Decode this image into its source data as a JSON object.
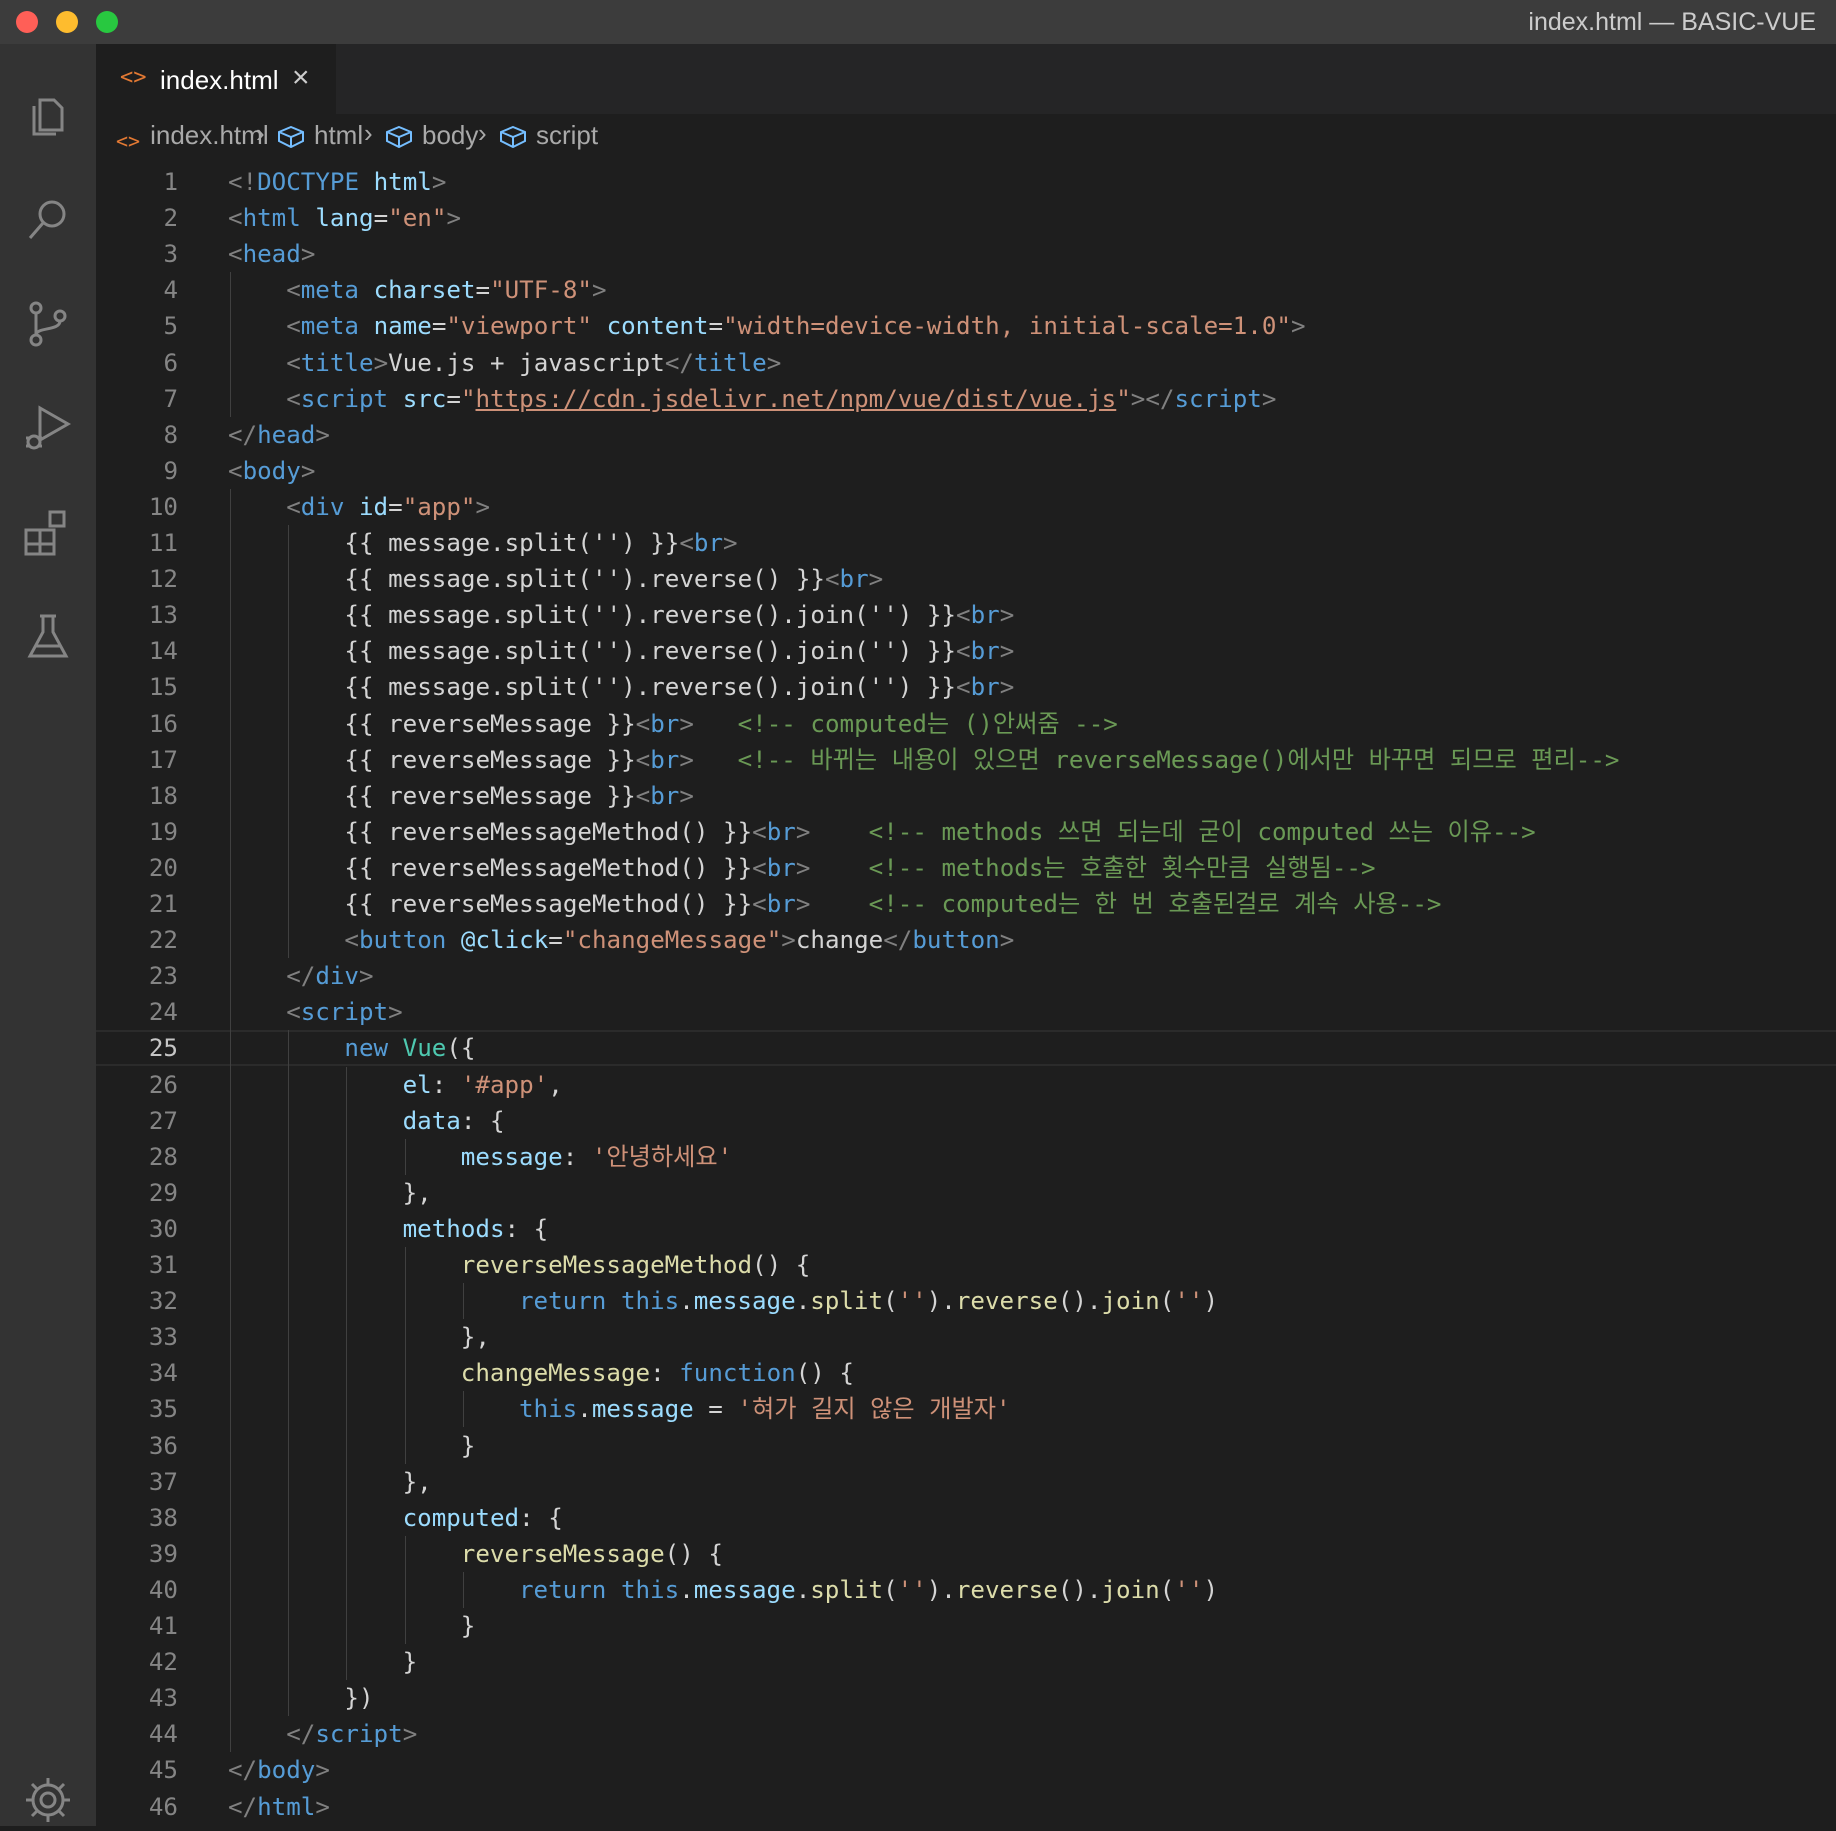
{
  "window": {
    "title": "index.html — BASIC-VUE"
  },
  "activity_bar": {
    "items": [
      {
        "name": "explorer-icon"
      },
      {
        "name": "search-icon"
      },
      {
        "name": "source-control-icon"
      },
      {
        "name": "run-debug-icon"
      },
      {
        "name": "extensions-icon"
      },
      {
        "name": "testing-icon"
      },
      {
        "name": "settings-gear-icon"
      }
    ]
  },
  "tab": {
    "label": "index.html",
    "close": "×"
  },
  "breadcrumb": {
    "items": [
      "index.html",
      "html",
      "body",
      "script"
    ]
  },
  "editor": {
    "current_line": 25,
    "lines": [
      {
        "n": "1",
        "indent": 0,
        "tokens": [
          [
            "p",
            "<!"
          ],
          [
            "tag",
            "DOCTYPE"
          ],
          [
            "txt",
            " "
          ],
          [
            "attr",
            "html"
          ],
          [
            "p",
            ">"
          ]
        ]
      },
      {
        "n": "2",
        "indent": 0,
        "tokens": [
          [
            "p",
            "<"
          ],
          [
            "tag",
            "html"
          ],
          [
            "txt",
            " "
          ],
          [
            "attr",
            "lang"
          ],
          [
            "txt",
            "="
          ],
          [
            "str",
            "\"en\""
          ],
          [
            "p",
            ">"
          ]
        ]
      },
      {
        "n": "3",
        "indent": 0,
        "tokens": [
          [
            "p",
            "<"
          ],
          [
            "tag",
            "head"
          ],
          [
            "p",
            ">"
          ]
        ]
      },
      {
        "n": "4",
        "indent": 1,
        "tokens": [
          [
            "p",
            "<"
          ],
          [
            "tag",
            "meta"
          ],
          [
            "txt",
            " "
          ],
          [
            "attr",
            "charset"
          ],
          [
            "txt",
            "="
          ],
          [
            "str",
            "\"UTF-8\""
          ],
          [
            "p",
            ">"
          ]
        ]
      },
      {
        "n": "5",
        "indent": 1,
        "tokens": [
          [
            "p",
            "<"
          ],
          [
            "tag",
            "meta"
          ],
          [
            "txt",
            " "
          ],
          [
            "attr",
            "name"
          ],
          [
            "txt",
            "="
          ],
          [
            "str",
            "\"viewport\""
          ],
          [
            "txt",
            " "
          ],
          [
            "attr",
            "content"
          ],
          [
            "txt",
            "="
          ],
          [
            "str",
            "\"width=device-width, initial-scale=1.0\""
          ],
          [
            "p",
            ">"
          ]
        ]
      },
      {
        "n": "6",
        "indent": 1,
        "tokens": [
          [
            "p",
            "<"
          ],
          [
            "tag",
            "title"
          ],
          [
            "p",
            ">"
          ],
          [
            "txt",
            "Vue.js + javascript"
          ],
          [
            "p",
            "</"
          ],
          [
            "tag",
            "title"
          ],
          [
            "p",
            ">"
          ]
        ]
      },
      {
        "n": "7",
        "indent": 1,
        "tokens": [
          [
            "p",
            "<"
          ],
          [
            "tag",
            "script"
          ],
          [
            "txt",
            " "
          ],
          [
            "attr",
            "src"
          ],
          [
            "txt",
            "="
          ],
          [
            "str",
            "\""
          ],
          [
            "link",
            "https://cdn.jsdelivr.net/npm/vue/dist/vue.js"
          ],
          [
            "str",
            "\""
          ],
          [
            "p",
            "></"
          ],
          [
            "tag",
            "script"
          ],
          [
            "p",
            ">"
          ]
        ]
      },
      {
        "n": "8",
        "indent": 0,
        "tokens": [
          [
            "p",
            "</"
          ],
          [
            "tag",
            "head"
          ],
          [
            "p",
            ">"
          ]
        ]
      },
      {
        "n": "9",
        "indent": 0,
        "tokens": [
          [
            "p",
            "<"
          ],
          [
            "tag",
            "body"
          ],
          [
            "p",
            ">"
          ]
        ]
      },
      {
        "n": "10",
        "indent": 1,
        "tokens": [
          [
            "p",
            "<"
          ],
          [
            "tag",
            "div"
          ],
          [
            "txt",
            " "
          ],
          [
            "attr",
            "id"
          ],
          [
            "txt",
            "="
          ],
          [
            "str",
            "\"app\""
          ],
          [
            "p",
            ">"
          ]
        ]
      },
      {
        "n": "11",
        "indent": 2,
        "tokens": [
          [
            "txt",
            "{{ message.split('') }}"
          ],
          [
            "p",
            "<"
          ],
          [
            "tag",
            "br"
          ],
          [
            "p",
            ">"
          ]
        ]
      },
      {
        "n": "12",
        "indent": 2,
        "tokens": [
          [
            "txt",
            "{{ message.split('').reverse() }}"
          ],
          [
            "p",
            "<"
          ],
          [
            "tag",
            "br"
          ],
          [
            "p",
            ">"
          ]
        ]
      },
      {
        "n": "13",
        "indent": 2,
        "tokens": [
          [
            "txt",
            "{{ message.split('').reverse().join('') }}"
          ],
          [
            "p",
            "<"
          ],
          [
            "tag",
            "br"
          ],
          [
            "p",
            ">"
          ]
        ]
      },
      {
        "n": "14",
        "indent": 2,
        "tokens": [
          [
            "txt",
            "{{ message.split('').reverse().join('') }}"
          ],
          [
            "p",
            "<"
          ],
          [
            "tag",
            "br"
          ],
          [
            "p",
            ">"
          ]
        ]
      },
      {
        "n": "15",
        "indent": 2,
        "tokens": [
          [
            "txt",
            "{{ message.split('').reverse().join('') }}"
          ],
          [
            "p",
            "<"
          ],
          [
            "tag",
            "br"
          ],
          [
            "p",
            ">"
          ]
        ]
      },
      {
        "n": "16",
        "indent": 2,
        "tokens": [
          [
            "txt",
            "{{ reverseMessage }}"
          ],
          [
            "p",
            "<"
          ],
          [
            "tag",
            "br"
          ],
          [
            "p",
            ">"
          ],
          [
            "txt",
            "   "
          ],
          [
            "cmt",
            "<!-- computed는 ()안써줌 -->"
          ]
        ]
      },
      {
        "n": "17",
        "indent": 2,
        "tokens": [
          [
            "txt",
            "{{ reverseMessage }}"
          ],
          [
            "p",
            "<"
          ],
          [
            "tag",
            "br"
          ],
          [
            "p",
            ">"
          ],
          [
            "txt",
            "   "
          ],
          [
            "cmt",
            "<!-- 바뀌는 내용이 있으면 reverseMessage()에서만 바꾸면 되므로 편리-->"
          ]
        ]
      },
      {
        "n": "18",
        "indent": 2,
        "tokens": [
          [
            "txt",
            "{{ reverseMessage }}"
          ],
          [
            "p",
            "<"
          ],
          [
            "tag",
            "br"
          ],
          [
            "p",
            ">"
          ]
        ]
      },
      {
        "n": "19",
        "indent": 2,
        "tokens": [
          [
            "txt",
            "{{ reverseMessageMethod() }}"
          ],
          [
            "p",
            "<"
          ],
          [
            "tag",
            "br"
          ],
          [
            "p",
            ">"
          ],
          [
            "txt",
            "    "
          ],
          [
            "cmt",
            "<!-- methods 쓰면 되는데 굳이 computed 쓰는 이유-->"
          ]
        ]
      },
      {
        "n": "20",
        "indent": 2,
        "tokens": [
          [
            "txt",
            "{{ reverseMessageMethod() }}"
          ],
          [
            "p",
            "<"
          ],
          [
            "tag",
            "br"
          ],
          [
            "p",
            ">"
          ],
          [
            "txt",
            "    "
          ],
          [
            "cmt",
            "<!-- methods는 호출한 횟수만큼 실행됨-->"
          ]
        ]
      },
      {
        "n": "21",
        "indent": 2,
        "tokens": [
          [
            "txt",
            "{{ reverseMessageMethod() }}"
          ],
          [
            "p",
            "<"
          ],
          [
            "tag",
            "br"
          ],
          [
            "p",
            ">"
          ],
          [
            "txt",
            "    "
          ],
          [
            "cmt",
            "<!-- computed는 한 번 호출된걸로 계속 사용-->"
          ]
        ]
      },
      {
        "n": "22",
        "indent": 2,
        "tokens": [
          [
            "p",
            "<"
          ],
          [
            "tag",
            "button"
          ],
          [
            "txt",
            " "
          ],
          [
            "attr",
            "@click"
          ],
          [
            "txt",
            "="
          ],
          [
            "str",
            "\"changeMessage\""
          ],
          [
            "p",
            ">"
          ],
          [
            "txt",
            "change"
          ],
          [
            "p",
            "</"
          ],
          [
            "tag",
            "button"
          ],
          [
            "p",
            ">"
          ]
        ]
      },
      {
        "n": "23",
        "indent": 1,
        "tokens": [
          [
            "p",
            "</"
          ],
          [
            "tag",
            "div"
          ],
          [
            "p",
            ">"
          ]
        ]
      },
      {
        "n": "24",
        "indent": 1,
        "tokens": [
          [
            "p",
            "<"
          ],
          [
            "tag",
            "script"
          ],
          [
            "p",
            ">"
          ]
        ]
      },
      {
        "n": "25",
        "indent": 2,
        "tokens": [
          [
            "kw",
            "new"
          ],
          [
            "txt",
            " "
          ],
          [
            "cls",
            "Vue"
          ],
          [
            "txt",
            "({"
          ]
        ]
      },
      {
        "n": "26",
        "indent": 3,
        "tokens": [
          [
            "prop",
            "el"
          ],
          [
            "txt",
            ": "
          ],
          [
            "str",
            "'#app'"
          ],
          [
            "txt",
            ","
          ]
        ]
      },
      {
        "n": "27",
        "indent": 3,
        "tokens": [
          [
            "prop",
            "data"
          ],
          [
            "txt",
            ": {"
          ]
        ]
      },
      {
        "n": "28",
        "indent": 4,
        "tokens": [
          [
            "prop",
            "message"
          ],
          [
            "txt",
            ": "
          ],
          [
            "str",
            "'안녕하세요'"
          ]
        ]
      },
      {
        "n": "29",
        "indent": 3,
        "tokens": [
          [
            "txt",
            "},"
          ]
        ]
      },
      {
        "n": "30",
        "indent": 3,
        "tokens": [
          [
            "prop",
            "methods"
          ],
          [
            "txt",
            ": {"
          ]
        ]
      },
      {
        "n": "31",
        "indent": 4,
        "tokens": [
          [
            "fn",
            "reverseMessageMethod"
          ],
          [
            "txt",
            "() {"
          ]
        ]
      },
      {
        "n": "32",
        "indent": 5,
        "tokens": [
          [
            "kw",
            "return"
          ],
          [
            "txt",
            " "
          ],
          [
            "kw",
            "this"
          ],
          [
            "txt",
            "."
          ],
          [
            "prop",
            "message"
          ],
          [
            "txt",
            "."
          ],
          [
            "fn",
            "split"
          ],
          [
            "txt",
            "("
          ],
          [
            "str",
            "''"
          ],
          [
            "txt",
            ")."
          ],
          [
            "fn",
            "reverse"
          ],
          [
            "txt",
            "()."
          ],
          [
            "fn",
            "join"
          ],
          [
            "txt",
            "("
          ],
          [
            "str",
            "''"
          ],
          [
            "txt",
            ")"
          ]
        ]
      },
      {
        "n": "33",
        "indent": 4,
        "tokens": [
          [
            "txt",
            "},"
          ]
        ]
      },
      {
        "n": "34",
        "indent": 4,
        "tokens": [
          [
            "fn",
            "changeMessage"
          ],
          [
            "txt",
            ": "
          ],
          [
            "kw",
            "function"
          ],
          [
            "txt",
            "() {"
          ]
        ]
      },
      {
        "n": "35",
        "indent": 5,
        "tokens": [
          [
            "kw",
            "this"
          ],
          [
            "txt",
            "."
          ],
          [
            "prop",
            "message"
          ],
          [
            "txt",
            " = "
          ],
          [
            "str",
            "'혀가 길지 않은 개발자'"
          ]
        ]
      },
      {
        "n": "36",
        "indent": 4,
        "tokens": [
          [
            "txt",
            "}"
          ]
        ]
      },
      {
        "n": "37",
        "indent": 3,
        "tokens": [
          [
            "txt",
            "},"
          ]
        ]
      },
      {
        "n": "38",
        "indent": 3,
        "tokens": [
          [
            "prop",
            "computed"
          ],
          [
            "txt",
            ": {"
          ]
        ]
      },
      {
        "n": "39",
        "indent": 4,
        "tokens": [
          [
            "fn",
            "reverseMessage"
          ],
          [
            "txt",
            "() {"
          ]
        ]
      },
      {
        "n": "40",
        "indent": 5,
        "tokens": [
          [
            "kw",
            "return"
          ],
          [
            "txt",
            " "
          ],
          [
            "kw",
            "this"
          ],
          [
            "txt",
            "."
          ],
          [
            "prop",
            "message"
          ],
          [
            "txt",
            "."
          ],
          [
            "fn",
            "split"
          ],
          [
            "txt",
            "("
          ],
          [
            "str",
            "''"
          ],
          [
            "txt",
            ")."
          ],
          [
            "fn",
            "reverse"
          ],
          [
            "txt",
            "()."
          ],
          [
            "fn",
            "join"
          ],
          [
            "txt",
            "("
          ],
          [
            "str",
            "''"
          ],
          [
            "txt",
            ")"
          ]
        ]
      },
      {
        "n": "41",
        "indent": 4,
        "tokens": [
          [
            "txt",
            "}"
          ]
        ]
      },
      {
        "n": "42",
        "indent": 3,
        "tokens": [
          [
            "txt",
            "}"
          ]
        ]
      },
      {
        "n": "43",
        "indent": 2,
        "tokens": [
          [
            "txt",
            "})"
          ]
        ]
      },
      {
        "n": "44",
        "indent": 1,
        "tokens": [
          [
            "p",
            "</"
          ],
          [
            "tag",
            "script"
          ],
          [
            "p",
            ">"
          ]
        ]
      },
      {
        "n": "45",
        "indent": 0,
        "tokens": [
          [
            "p",
            "</"
          ],
          [
            "tag",
            "body"
          ],
          [
            "p",
            ">"
          ]
        ]
      },
      {
        "n": "46",
        "indent": 0,
        "tokens": [
          [
            "p",
            "</"
          ],
          [
            "tag",
            "html"
          ],
          [
            "p",
            ">"
          ]
        ]
      }
    ]
  },
  "colors": {
    "background": "#1e1e1e",
    "activity_bar": "#333333",
    "title_bar": "#3c3c3c",
    "tag": "#569cd6",
    "attribute": "#9cdcfe",
    "string": "#ce9178",
    "comment": "#6a9955",
    "function": "#dcdcaa",
    "class": "#4ec9b0",
    "line_number": "#858585"
  }
}
